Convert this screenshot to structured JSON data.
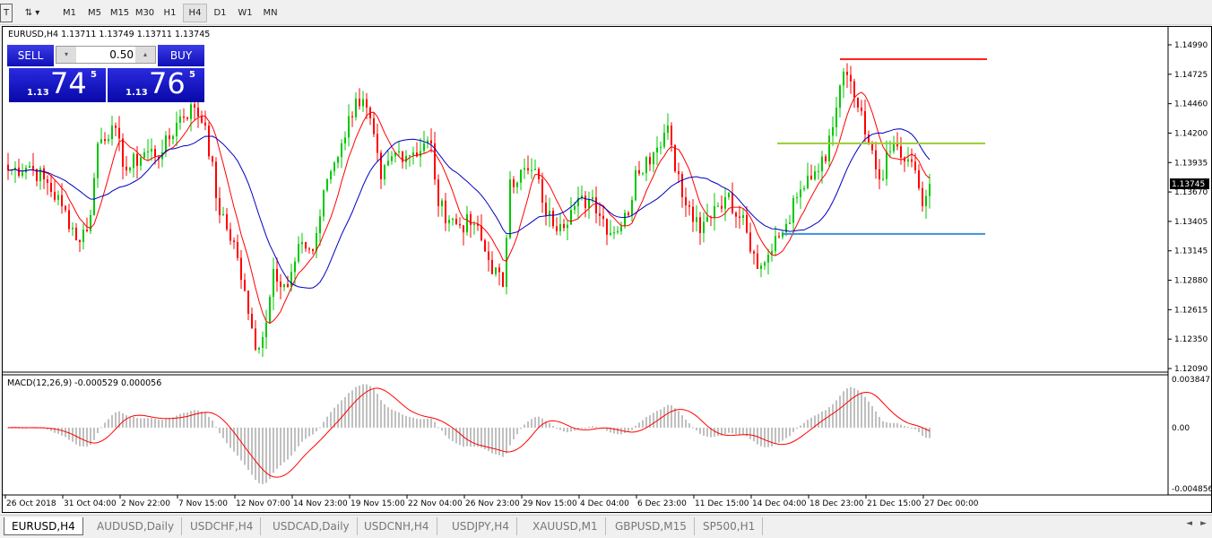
{
  "toolbar": {
    "timeframes": [
      "M1",
      "M5",
      "M15",
      "M30",
      "H1",
      "H4",
      "D1",
      "W1",
      "MN"
    ],
    "active": "H4"
  },
  "chart": {
    "title": "EURUSD,H4  1.13711 1.13749 1.13711 1.13745",
    "trade": {
      "sell_label": "SELL",
      "buy_label": "BUY",
      "lot": "0.50",
      "sell_small": "1.13",
      "sell_large": "74",
      "sell_pip": "5",
      "buy_small": "1.13",
      "buy_large": "76",
      "buy_pip": "5"
    },
    "price_axis": [
      "1.14990",
      "1.14725",
      "1.14460",
      "1.14200",
      "1.13935",
      "1.13670",
      "1.13405",
      "1.13145",
      "1.12880",
      "1.12615",
      "1.12350",
      "1.12090"
    ],
    "current_price": "1.13745",
    "hlines": [
      {
        "price": 1.14861,
        "color": "#ff2020"
      },
      {
        "price": 1.14107,
        "color": "#9acd32"
      },
      {
        "price": 1.13296,
        "color": "#3d8fe0"
      }
    ],
    "colors": {
      "up": "#00c800",
      "down": "#ff0000",
      "ma_fast": "#ff0000",
      "ma_slow": "#0000c0",
      "macd_hist": "#c0c0c0",
      "macd_signal": "#ff0000"
    },
    "time_axis": [
      "26 Oct 2018",
      "31 Oct 04:00",
      "2 Nov 22:00",
      "7 Nov 15:00",
      "12 Nov 07:00",
      "14 Nov 23:00",
      "19 Nov 15:00",
      "22 Nov 04:00",
      "26 Nov 23:00",
      "29 Nov 15:00",
      "4 Dec 04:00",
      "6 Dec 23:00",
      "11 Dec 15:00",
      "14 Dec 04:00",
      "18 Dec 23:00",
      "21 Dec 15:00",
      "27 Dec 00:00"
    ],
    "macd": {
      "label": "MACD(12,26,9) -0.000529 0.000056",
      "axis": [
        "0.003847",
        "0.00",
        "-0.004856"
      ]
    }
  },
  "chart_data": {
    "type": "candlestick",
    "symbol": "EURUSD",
    "timeframe": "H4",
    "ylim": [
      1.1209,
      1.1499
    ],
    "key_closes": [
      [
        0,
        1.13866
      ],
      [
        6,
        1.13906
      ],
      [
        10,
        1.13785
      ],
      [
        15,
        1.13545
      ],
      [
        20,
        1.13223
      ],
      [
        23,
        1.13464
      ],
      [
        25,
        1.14107
      ],
      [
        29,
        1.14267
      ],
      [
        33,
        1.13866
      ],
      [
        38,
        1.14026
      ],
      [
        43,
        1.14026
      ],
      [
        48,
        1.14348
      ],
      [
        52,
        1.14428
      ],
      [
        55,
        1.14267
      ],
      [
        59,
        1.13464
      ],
      [
        63,
        1.13223
      ],
      [
        67,
        1.12581
      ],
      [
        69,
        1.1226
      ],
      [
        72,
        1.12501
      ],
      [
        74,
        1.12982
      ],
      [
        78,
        1.12822
      ],
      [
        82,
        1.13223
      ],
      [
        85,
        1.13143
      ],
      [
        89,
        1.13785
      ],
      [
        93,
        1.14107
      ],
      [
        97,
        1.14508
      ],
      [
        100,
        1.14428
      ],
      [
        104,
        1.13785
      ],
      [
        108,
        1.14026
      ],
      [
        113,
        1.14026
      ],
      [
        118,
        1.14107
      ],
      [
        120,
        1.13545
      ],
      [
        125,
        1.13384
      ],
      [
        130,
        1.13384
      ],
      [
        134,
        1.13063
      ],
      [
        138,
        1.12822
      ],
      [
        140,
        1.13785
      ],
      [
        145,
        1.13866
      ],
      [
        148,
        1.13785
      ],
      [
        150,
        1.13464
      ],
      [
        154,
        1.13384
      ],
      [
        158,
        1.13545
      ],
      [
        163,
        1.13625
      ],
      [
        168,
        1.13304
      ],
      [
        173,
        1.13464
      ],
      [
        175,
        1.13866
      ],
      [
        180,
        1.14026
      ],
      [
        184,
        1.14267
      ],
      [
        188,
        1.13625
      ],
      [
        193,
        1.13304
      ],
      [
        197,
        1.13545
      ],
      [
        200,
        1.13625
      ],
      [
        205,
        1.13464
      ],
      [
        209,
        1.12982
      ],
      [
        213,
        1.13143
      ],
      [
        217,
        1.13384
      ],
      [
        220,
        1.13625
      ],
      [
        224,
        1.13785
      ],
      [
        228,
        1.13946
      ],
      [
        233,
        1.14749
      ],
      [
        237,
        1.14428
      ],
      [
        239,
        1.14187
      ],
      [
        243,
        1.13785
      ],
      [
        247,
        1.14107
      ],
      [
        250,
        1.13945
      ],
      [
        253,
        1.13866
      ],
      [
        255,
        1.13545
      ],
      [
        257,
        1.13745
      ]
    ],
    "macd_ylim": [
      -0.004856,
      0.003847
    ]
  },
  "tabs": [
    {
      "label": "EURUSD,H4",
      "active": true
    },
    {
      "label": "AUDUSD,Daily"
    },
    {
      "label": "USDCHF,H4"
    },
    {
      "label": "USDCAD,Daily"
    },
    {
      "label": "USDCNH,H4"
    },
    {
      "label": "USDJPY,H4"
    },
    {
      "label": "XAUUSD,M1"
    },
    {
      "label": "GBPUSD,M15"
    },
    {
      "label": "SP500,H1"
    }
  ],
  "tab_scroll": {
    "left": "◄",
    "right": "►"
  }
}
